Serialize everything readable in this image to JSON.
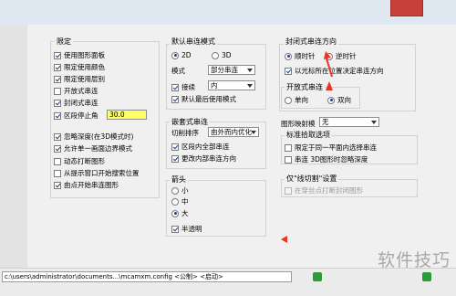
{
  "left_group": {
    "title": "限定",
    "items": [
      {
        "label": "使用图形面板",
        "checked": true
      },
      {
        "label": "限定使用颜色",
        "checked": true
      },
      {
        "label": "限定使用层别",
        "checked": true
      },
      {
        "label": "开放式串连",
        "checked": false
      },
      {
        "label": "封闭式串连",
        "checked": true
      },
      {
        "label": "区段停止角",
        "checked": true
      }
    ],
    "stop_angle_value": "30.0",
    "items2": [
      {
        "label": "忽略深度(在3D模式时)",
        "checked": true
      },
      {
        "label": "允许单一画面边界模式",
        "checked": true
      },
      {
        "label": "动态打断图形",
        "checked": false
      },
      {
        "label": "从提示窗口开始搜索位置",
        "checked": false
      },
      {
        "label": "由点开始串连图形",
        "checked": true
      }
    ]
  },
  "default_mode": {
    "title": "默认串连模式",
    "opt_2d": "2D",
    "opt_3d": "3D",
    "mode_label": "模式",
    "mode_value": "部分串连",
    "contact_label": "接续",
    "contact_value": "内",
    "use_last": "默认最后使用模式"
  },
  "nested": {
    "title": "嵌套式串连",
    "order_label": "切削排序",
    "order_value": "由外而内优化",
    "opt1": "区段内全部串连",
    "opt2": "更改内部串连方向"
  },
  "arrow": {
    "title": "箭头",
    "small": "小",
    "medium": "中",
    "large": "大",
    "translucent": "半透明"
  },
  "closed_dir": {
    "title": "封闭式串连方向",
    "cw": "顺时针",
    "ccw": "逆时针",
    "cursor": "以光标所在位置决定串连方向"
  },
  "open_type": {
    "title": "开放式串连",
    "single": "单向",
    "double": "双向"
  },
  "mapping": {
    "label": "图形映射模",
    "value": "无"
  },
  "std_select": {
    "title": "标准拾取选项",
    "opt1": "限定于同一平面内选择串连",
    "opt2": "串连 3D图形时忽略深度"
  },
  "chain_cut": {
    "title": "仅\"线切割\"设置",
    "opt": "在穿丝点打断封闭图形"
  },
  "status_path": "c:\\users\\administrator\\documents...\\mcamxm.config <公制> <启动>",
  "watermark": "软件技巧",
  "colors": {
    "annotation": "#e8332a",
    "highlight": "#ffff66",
    "close": "#c7403a"
  }
}
